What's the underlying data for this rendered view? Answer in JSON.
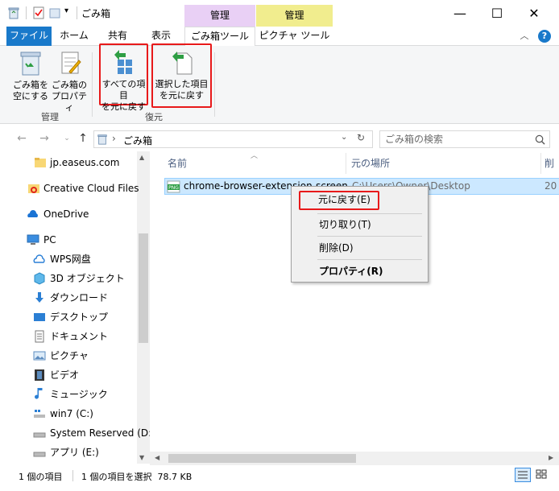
{
  "titlebar": {
    "title": "ごみ箱",
    "context_tab_manage1": "管理",
    "context_tab_manage2": "管理",
    "minimize": "—",
    "maximize": "☐",
    "close": "✕"
  },
  "tabs": {
    "file": "ファイル",
    "home": "ホーム",
    "share": "共有",
    "view": "表示",
    "recycle_tools": "ごみ箱ツール",
    "picture_tools": "ピクチャ ツール"
  },
  "ribbon": {
    "empty_line1": "ごみ箱を",
    "empty_line2": "空にする",
    "props_line1": "ごみ箱の",
    "props_line2": "プロパティ",
    "restore_all_line1": "すべての項目",
    "restore_all_line2": "を元に戻す",
    "restore_sel_line1": "選択した項目",
    "restore_sel_line2": "を元に戻す",
    "group_manage": "管理",
    "group_restore": "復元"
  },
  "address": {
    "location": "ごみ箱",
    "search_placeholder": "ごみ箱の検索"
  },
  "nav": [
    "jp.easeus.com",
    "Creative Cloud Files",
    "OneDrive",
    "PC",
    "WPS网盘",
    "3D オブジェクト",
    "ダウンロード",
    "デスクトップ",
    "ドキュメント",
    "ピクチャ",
    "ビデオ",
    "ミュージック",
    "win7 (C:)",
    "System Reserved (D:)",
    "アプリ (E:)"
  ],
  "columns": {
    "name": "名前",
    "original_location": "元の場所",
    "deleted": "削"
  },
  "file": {
    "name": "chrome-browser-extension-screen...",
    "location": "C:\\Users\\Owner\\Desktop",
    "date": "20"
  },
  "context_menu": {
    "restore": "元に戻す(E)",
    "cut": "切り取り(T)",
    "delete": "削除(D)",
    "properties": "プロパティ(R)"
  },
  "status": {
    "count": "1 個の項目",
    "selected": "1 個の項目を選択  78.7 KB"
  },
  "colors": {
    "file_tab": "#1979ca",
    "highlight": "#e8191a",
    "selection": "#cce8ff"
  }
}
